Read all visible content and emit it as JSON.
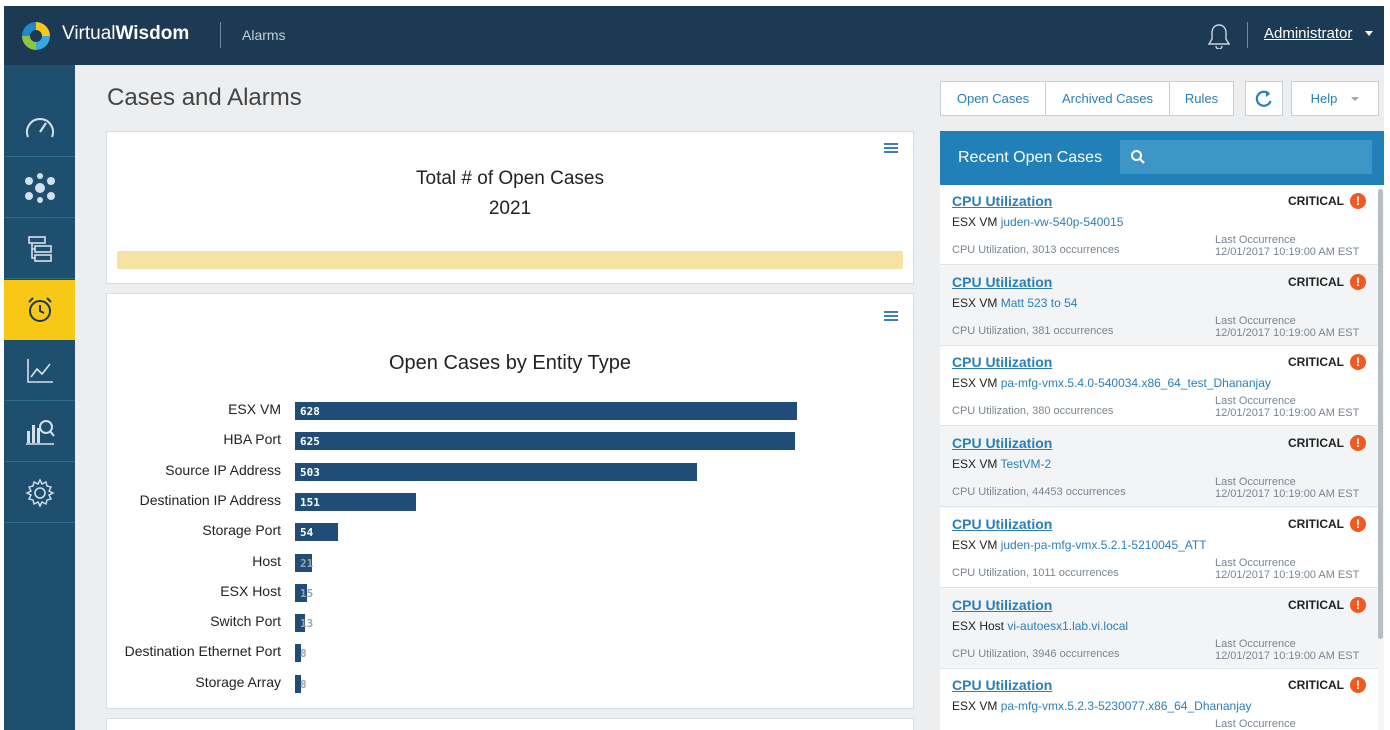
{
  "header": {
    "brand_light": "Virtual",
    "brand_bold": "Wisdom",
    "module": "Alarms",
    "user": "Administrator"
  },
  "sidebar": {
    "items": [
      {
        "name": "dashboard",
        "icon": "speedometer-icon",
        "active": false
      },
      {
        "name": "topology",
        "icon": "network-icon",
        "active": false
      },
      {
        "name": "hierarchy",
        "icon": "tree-icon",
        "active": false
      },
      {
        "name": "alarms",
        "icon": "alarm-clock-icon",
        "active": true
      },
      {
        "name": "trends",
        "icon": "line-chart-icon",
        "active": false
      },
      {
        "name": "analytics",
        "icon": "bar-chart-search-icon",
        "active": false
      },
      {
        "name": "settings",
        "icon": "gear-icon",
        "active": false
      }
    ]
  },
  "page": {
    "title": "Cases and Alarms"
  },
  "toolbar": {
    "open_cases": "Open Cases",
    "archived_cases": "Archived Cases",
    "rules": "Rules",
    "help": "Help"
  },
  "total_panel": {
    "title": "Total # of Open Cases",
    "value": "2021"
  },
  "chart_data": {
    "type": "bar",
    "orientation": "horizontal",
    "title": "Open Cases by Entity Type",
    "categories": [
      "ESX VM",
      "HBA Port",
      "Source IP Address",
      "Destination IP Address",
      "Storage Port",
      "Host",
      "ESX Host",
      "Switch Port",
      "Destination Ethernet Port",
      "Storage Array"
    ],
    "values": [
      628,
      625,
      503,
      151,
      54,
      21,
      15,
      13,
      8,
      8
    ],
    "xlim": [
      0,
      700
    ],
    "grid": false,
    "color": "#1f4d77"
  },
  "recent": {
    "title": "Recent Open Cases",
    "cases": [
      {
        "title": "CPU Utilization",
        "severity": "CRITICAL",
        "entity_type": "ESX VM",
        "entity_name": "juden-vw-540p-540015",
        "occurrences": "CPU Utilization, 3013 occurrences",
        "last_label": "Last Occurrence",
        "last_date": "12/01/2017 10:19:00 AM EST"
      },
      {
        "title": "CPU Utilization",
        "severity": "CRITICAL",
        "entity_type": "ESX VM",
        "entity_name": "Matt 523 to 54",
        "occurrences": "CPU Utilization, 381 occurrences",
        "last_label": "Last Occurrence",
        "last_date": "12/01/2017 10:19:00 AM EST"
      },
      {
        "title": "CPU Utilization",
        "severity": "CRITICAL",
        "entity_type": "ESX VM",
        "entity_name": "pa-mfg-vmx.5.4.0-540034.x86_64_test_Dhananjay",
        "occurrences": "CPU Utilization, 380 occurrences",
        "last_label": "Last Occurrence",
        "last_date": "12/01/2017 10:19:00 AM EST"
      },
      {
        "title": "CPU Utilization",
        "severity": "CRITICAL",
        "entity_type": "ESX VM",
        "entity_name": "TestVM-2",
        "occurrences": "CPU Utilization, 44453 occurrences",
        "last_label": "Last Occurrence",
        "last_date": "12/01/2017 10:19:00 AM EST"
      },
      {
        "title": "CPU Utilization",
        "severity": "CRITICAL",
        "entity_type": "ESX VM",
        "entity_name": "juden-pa-mfg-vmx.5.2.1-5210045_ATT",
        "occurrences": "CPU Utilization, 1011 occurrences",
        "last_label": "Last Occurrence",
        "last_date": "12/01/2017 10:19:00 AM EST"
      },
      {
        "title": "CPU Utilization",
        "severity": "CRITICAL",
        "entity_type": "ESX Host",
        "entity_name": "vi-autoesx1.lab.vi.local",
        "occurrences": "CPU Utilization, 3946 occurrences",
        "last_label": "Last Occurrence",
        "last_date": "12/01/2017 10:19:00 AM EST"
      },
      {
        "title": "CPU Utilization",
        "severity": "CRITICAL",
        "entity_type": "ESX VM",
        "entity_name": "pa-mfg-vmx.5.2.3-5230077.x86_64_Dhananjay",
        "occurrences": "",
        "last_label": "Last Occurrence",
        "last_date": ""
      }
    ]
  }
}
